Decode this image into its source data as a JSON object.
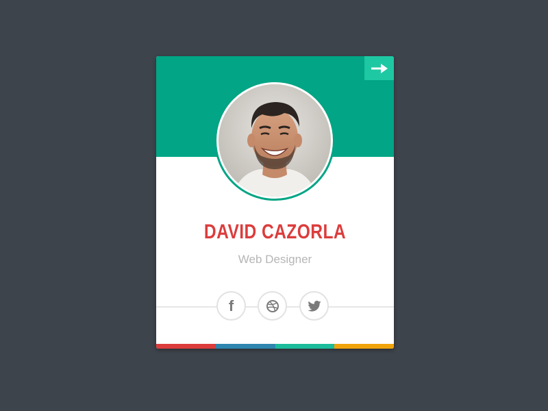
{
  "profile": {
    "name": "DAVID CAZORLA",
    "role": "Web Designer",
    "avatar_alt": "Profile photo of a smiling man"
  },
  "actions": {
    "next_icon": "arrow-right-icon"
  },
  "social": [
    {
      "network": "facebook",
      "icon": "facebook-icon",
      "glyph": "f"
    },
    {
      "network": "dribbble",
      "icon": "dribbble-icon"
    },
    {
      "network": "twitter",
      "icon": "twitter-icon"
    }
  ],
  "colors": {
    "background": "#3e444c",
    "header": "#02a585",
    "arrow_button": "#1ec8a2",
    "name": "#dc3c3c",
    "role": "#b5b5b5",
    "stripes": [
      "#dc3c3c",
      "#2e86ae",
      "#1abc9c",
      "#f0a30a"
    ]
  }
}
